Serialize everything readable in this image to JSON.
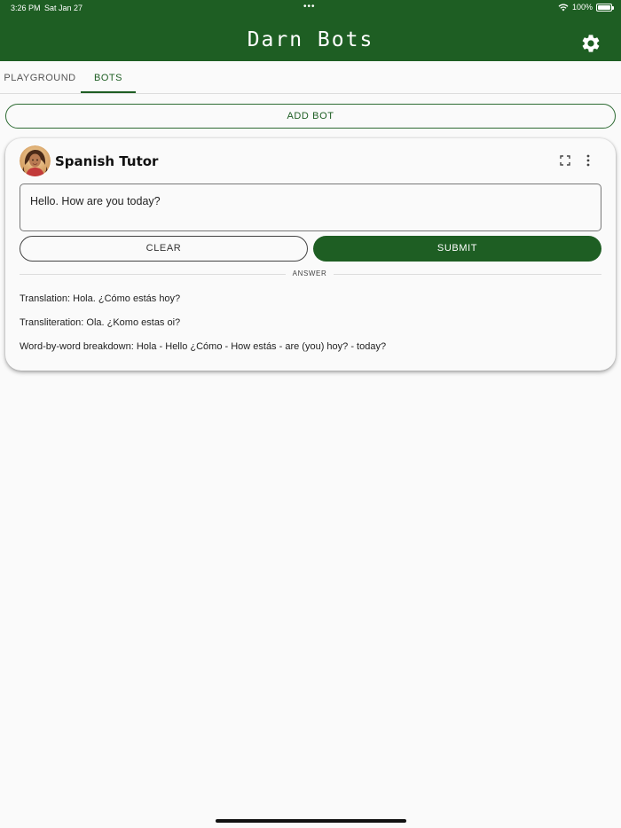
{
  "status_bar": {
    "time": "3:26 PM",
    "date": "Sat Jan 27",
    "dots": "•••",
    "battery": "100%"
  },
  "header": {
    "title": "Darn Bots",
    "background_color": "#1e5e23",
    "settings_icon": "gear-icon"
  },
  "tabs": [
    {
      "label": "PLAYGROUND",
      "active": false
    },
    {
      "label": "BOTS",
      "active": true
    }
  ],
  "add_bot_label": "ADD BOT",
  "bot_card": {
    "name": "Spanish Tutor",
    "avatar_icon": "avatar-icon",
    "prompt_value": "Hello. How are you today?",
    "clear_label": "CLEAR",
    "submit_label": "SUBMIT",
    "answer_label": "ANSWER",
    "answer_lines": [
      "Translation: Hola. ¿Cómo estás hoy?",
      "Transliteration: Ola. ¿Komo estas oi?",
      "Word-by-word breakdown: Hola - Hello ¿Cómo - How estás - are (you) hoy? - today?"
    ]
  },
  "colors": {
    "accent": "#1e5e23",
    "background": "#fafafa"
  }
}
